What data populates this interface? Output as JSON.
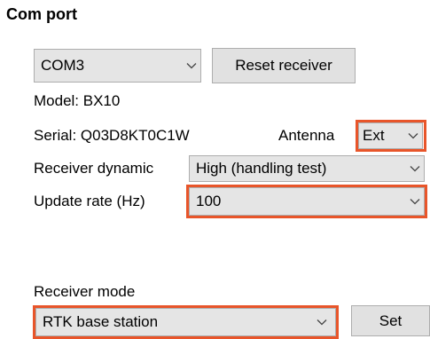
{
  "section_title": "Com port",
  "com_port": {
    "selected": "COM3"
  },
  "reset_button_label": "Reset receiver",
  "model": "Model: BX10",
  "serial": "Serial: Q03D8KT0C1W",
  "antenna": {
    "label": "Antenna",
    "selected": "Ext"
  },
  "receiver_dynamic": {
    "label": "Receiver dynamic",
    "selected": "High (handling test)"
  },
  "update_rate": {
    "label": "Update rate (Hz)",
    "selected": "100"
  },
  "receiver_mode": {
    "label": "Receiver mode",
    "selected": "RTK base station"
  },
  "set_button_label": "Set",
  "highlight_color": "#e8552a"
}
